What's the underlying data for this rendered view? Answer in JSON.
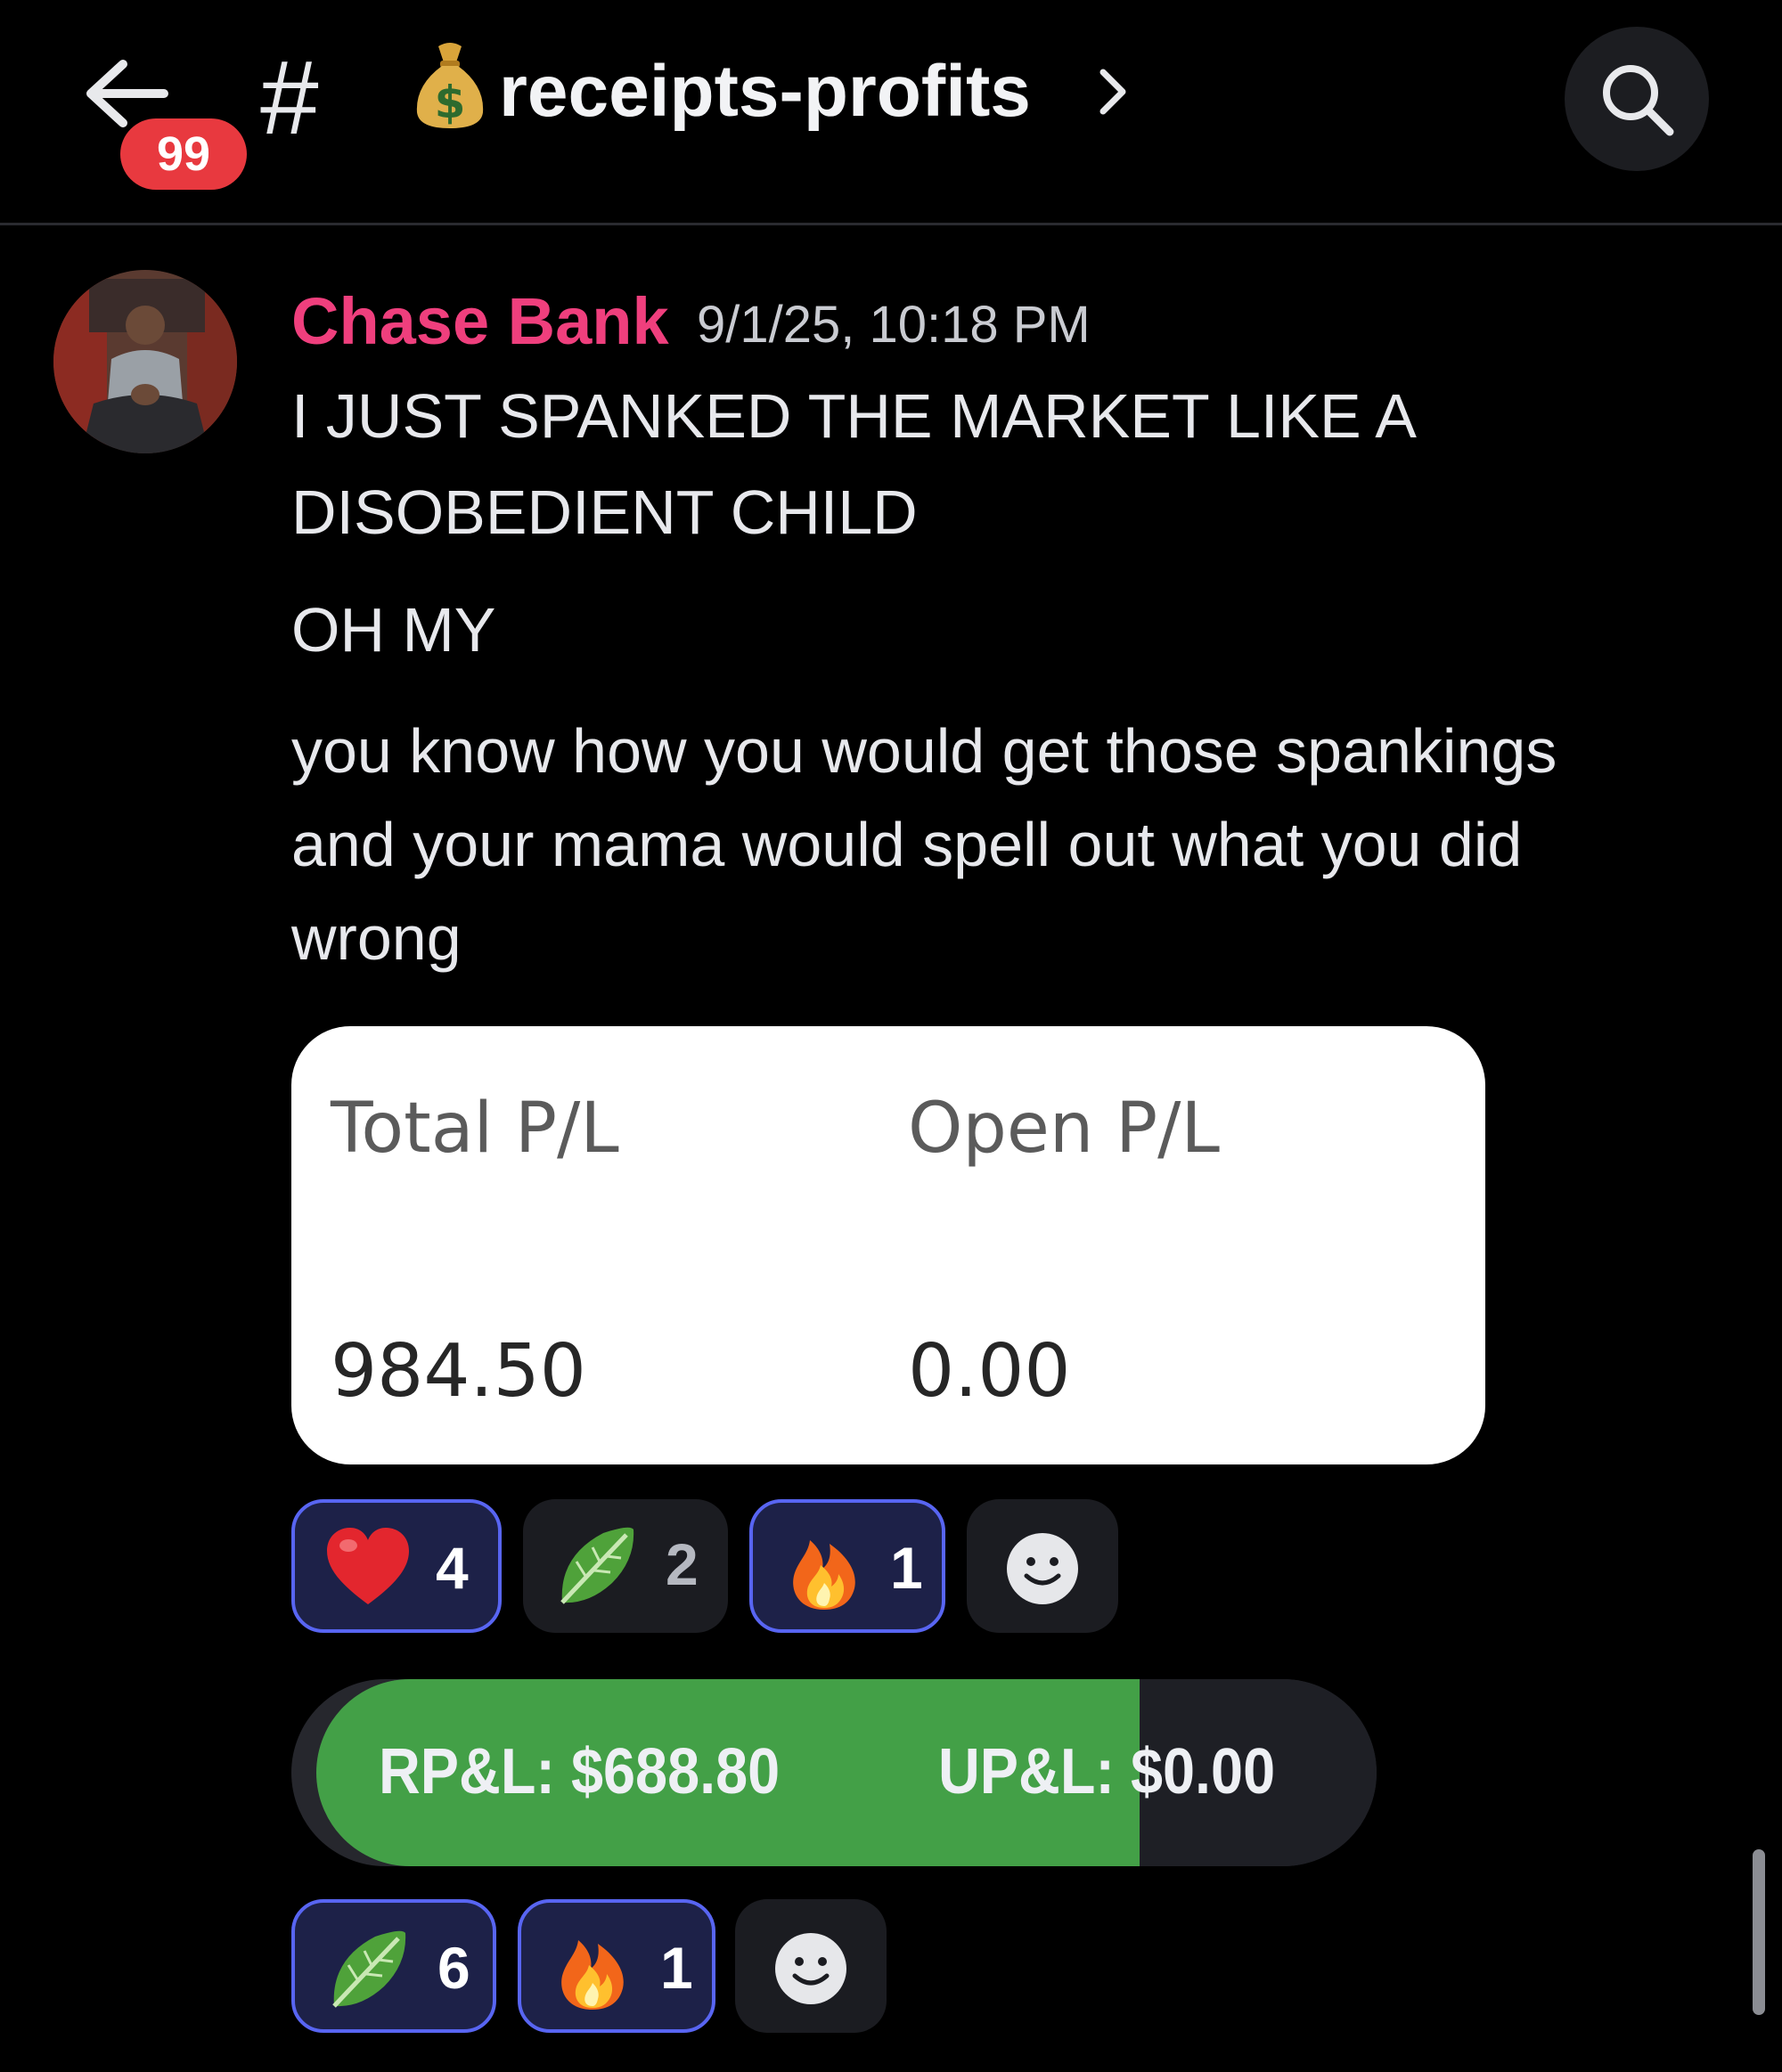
{
  "header": {
    "unread_count": "99",
    "hash": "#",
    "channel_name": "receipts-profits",
    "channel_emoji": "money-bag-icon"
  },
  "message": {
    "author": "Chase Bank",
    "author_color": "#ef3f7d",
    "timestamp": "9/1/25, 10:18 PM",
    "lines": [
      "I JUST SPANKED THE MARKET LIKE A",
      "DISOBEDIENT CHILD",
      "OH MY",
      "you know how you would get those spankings",
      "and your mama would spell out what you did",
      "wrong"
    ]
  },
  "pl_card": {
    "total_label": "Total P/L",
    "total_value": "984.50",
    "open_label": "Open P/L",
    "open_value": "0.00"
  },
  "reactions_1": [
    {
      "emoji": "red-heart-icon",
      "count": "4",
      "selected": true
    },
    {
      "emoji": "leafy-green-icon",
      "count": "2",
      "selected": false
    },
    {
      "emoji": "fire-icon",
      "count": "1",
      "selected": true
    }
  ],
  "pnl_bar": {
    "realized": "RP&L: $688.80",
    "unrealized": "UP&L: $0.00",
    "realized_color": "#43a047"
  },
  "reactions_2": [
    {
      "emoji": "leafy-green-icon",
      "count": "6",
      "selected": true
    },
    {
      "emoji": "fire-icon",
      "count": "1",
      "selected": true
    }
  ]
}
